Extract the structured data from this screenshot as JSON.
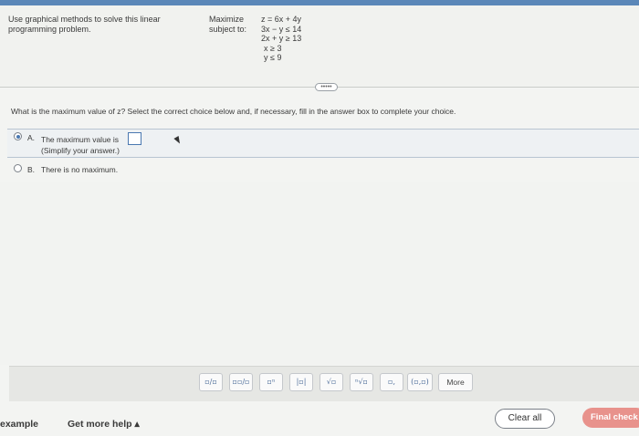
{
  "problem": {
    "instructions": "Use graphical methods to solve this linear programming problem.",
    "maximize_label": "Maximize",
    "subject_label": "subject to:",
    "objective": "z = 6x + 4y",
    "constraints": [
      "3x − y ≤ 14",
      "2x + y ≥ 13",
      "x ≥ 3",
      "y ≤ 9"
    ]
  },
  "expand_label": "•••••",
  "question": "What is the maximum value of z? Select the correct choice below and, if necessary, fill in the answer box to complete your choice.",
  "choices": {
    "a": {
      "letter": "A.",
      "text": "The maximum value is",
      "hint": "(Simplify your answer.)",
      "selected": true
    },
    "b": {
      "letter": "B.",
      "text": "There is no maximum.",
      "selected": false
    }
  },
  "toolbar": {
    "buttons": [
      "▫/▫",
      "▫▫/▫",
      "▫ⁿ",
      "|▫|",
      "√▫",
      "ⁿ√▫",
      "▫,",
      "(▫,▫)"
    ],
    "more_label": "More"
  },
  "footer": {
    "example_label": "example",
    "help_label": "Get more help ▴",
    "clear_label": "Clear all",
    "final_label": "Final check"
  }
}
